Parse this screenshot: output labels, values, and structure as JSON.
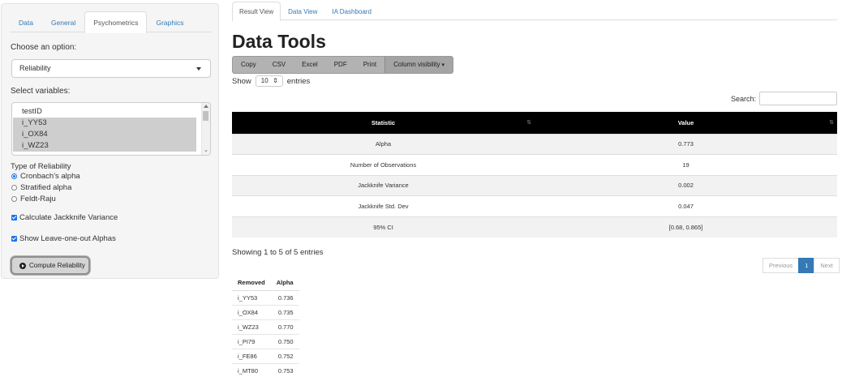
{
  "sidebar": {
    "tabs": [
      {
        "label": "Data"
      },
      {
        "label": "General"
      },
      {
        "label": "Psychometrics"
      },
      {
        "label": "Graphics"
      }
    ],
    "choose_label": "Choose an option:",
    "option_selected": "Reliability",
    "variables_label": "Select variables:",
    "variables": [
      {
        "label": "testID",
        "selected": false
      },
      {
        "label": "i_YY53",
        "selected": true
      },
      {
        "label": "i_OX84",
        "selected": true
      },
      {
        "label": "i_WZ23",
        "selected": true
      }
    ],
    "reliability_type_label": "Type of Reliability",
    "reliability_types": [
      {
        "label": "Cronbach's alpha",
        "checked": true
      },
      {
        "label": "Stratified alpha",
        "checked": false
      },
      {
        "label": "Feldt-Raju",
        "checked": false
      }
    ],
    "jackknife_label": "Calculate Jackknife Variance",
    "leave_one_out_label": "Show Leave-one-out Alphas",
    "compute_label": "Compute Reliability"
  },
  "main": {
    "tabs": [
      {
        "label": "Result View"
      },
      {
        "label": "Data View"
      },
      {
        "label": "IA Dashboard"
      }
    ],
    "title": "Data Tools",
    "buttons": {
      "copy": "Copy",
      "csv": "CSV",
      "excel": "Excel",
      "pdf": "PDF",
      "print": "Print",
      "colvis": "Column visibility"
    },
    "show_label": "Show",
    "entries_value": "10",
    "entries_label": "entries",
    "search_label": "Search:",
    "table": {
      "headers": [
        "Statistic",
        "Value"
      ],
      "rows": [
        [
          "Alpha",
          "0.773"
        ],
        [
          "Number of Observations",
          "19"
        ],
        [
          "Jackknife Variance",
          "0.002"
        ],
        [
          "Jackknife Std. Dev",
          "0.047"
        ],
        [
          "95% CI",
          "[0.68, 0.865]"
        ]
      ]
    },
    "info": "Showing 1 to 5 of 5 entries",
    "pager": {
      "previous": "Previous",
      "current": "1",
      "next": "Next"
    },
    "loo": {
      "headers": [
        "Removed",
        "Alpha"
      ],
      "rows": [
        [
          "i_YY53",
          "0.736"
        ],
        [
          "i_OX84",
          "0.735"
        ],
        [
          "i_WZ23",
          "0.770"
        ],
        [
          "i_PI79",
          "0.750"
        ],
        [
          "i_FE86",
          "0.752"
        ],
        [
          "i_MT80",
          "0.753"
        ]
      ]
    }
  },
  "colors": {
    "accent": "#1a73e8",
    "link": "#337ab7",
    "table_header": "#000000"
  }
}
